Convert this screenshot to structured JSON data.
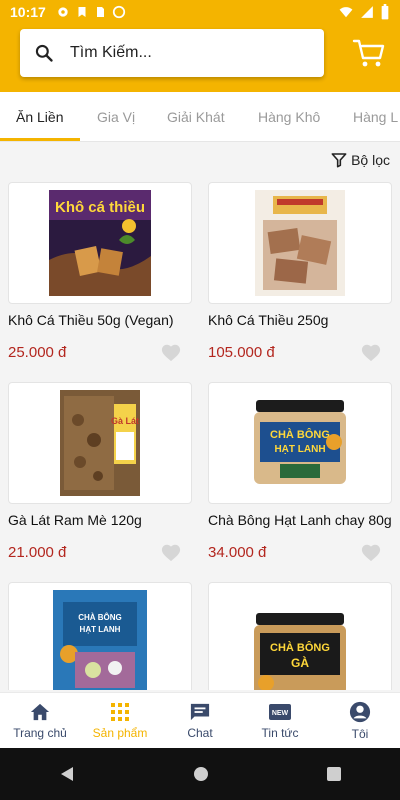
{
  "status": {
    "time": "10:17"
  },
  "search": {
    "placeholder": "Tìm Kiếm..."
  },
  "tabs": [
    {
      "label": "Ăn Liền",
      "active": true
    },
    {
      "label": "Gia Vị"
    },
    {
      "label": "Giải Khát"
    },
    {
      "label": "Hàng Khô"
    },
    {
      "label": "Hàng L"
    }
  ],
  "filter": {
    "label": "Bộ lọc"
  },
  "products": [
    {
      "name": "Khô Cá Thiều 50g (Vegan)",
      "price": "25.000 đ",
      "img_text": "Khô cá thiều"
    },
    {
      "name": "Khô Cá Thiều 250g",
      "price": "105.000 đ",
      "img_text": ""
    },
    {
      "name": "Gà Lát Ram Mè 120g",
      "price": "21.000 đ",
      "img_text": "Gà Lát"
    },
    {
      "name": "Chà Bông Hạt Lanh chay 80g",
      "price": "34.000 đ",
      "img_text": "CHÀ BÔNG HẠT LANH"
    },
    {
      "name": "",
      "price": "",
      "img_text": "CHÀ BÔNG HẠT LANH"
    },
    {
      "name": "",
      "price": "",
      "img_text": "CHÀ BÔNG GÀ"
    }
  ],
  "nav": [
    {
      "label": "Trang chủ",
      "icon": "home-icon"
    },
    {
      "label": "Sản phẩm",
      "icon": "grid-icon",
      "active": true
    },
    {
      "label": "Chat",
      "icon": "chat-icon"
    },
    {
      "label": "Tin tức",
      "icon": "news-icon"
    },
    {
      "label": "Tôi",
      "icon": "account-icon"
    }
  ],
  "colors": {
    "accent": "#f4b400",
    "price": "#b3261e",
    "nav_inactive": "#3a4a6b"
  }
}
